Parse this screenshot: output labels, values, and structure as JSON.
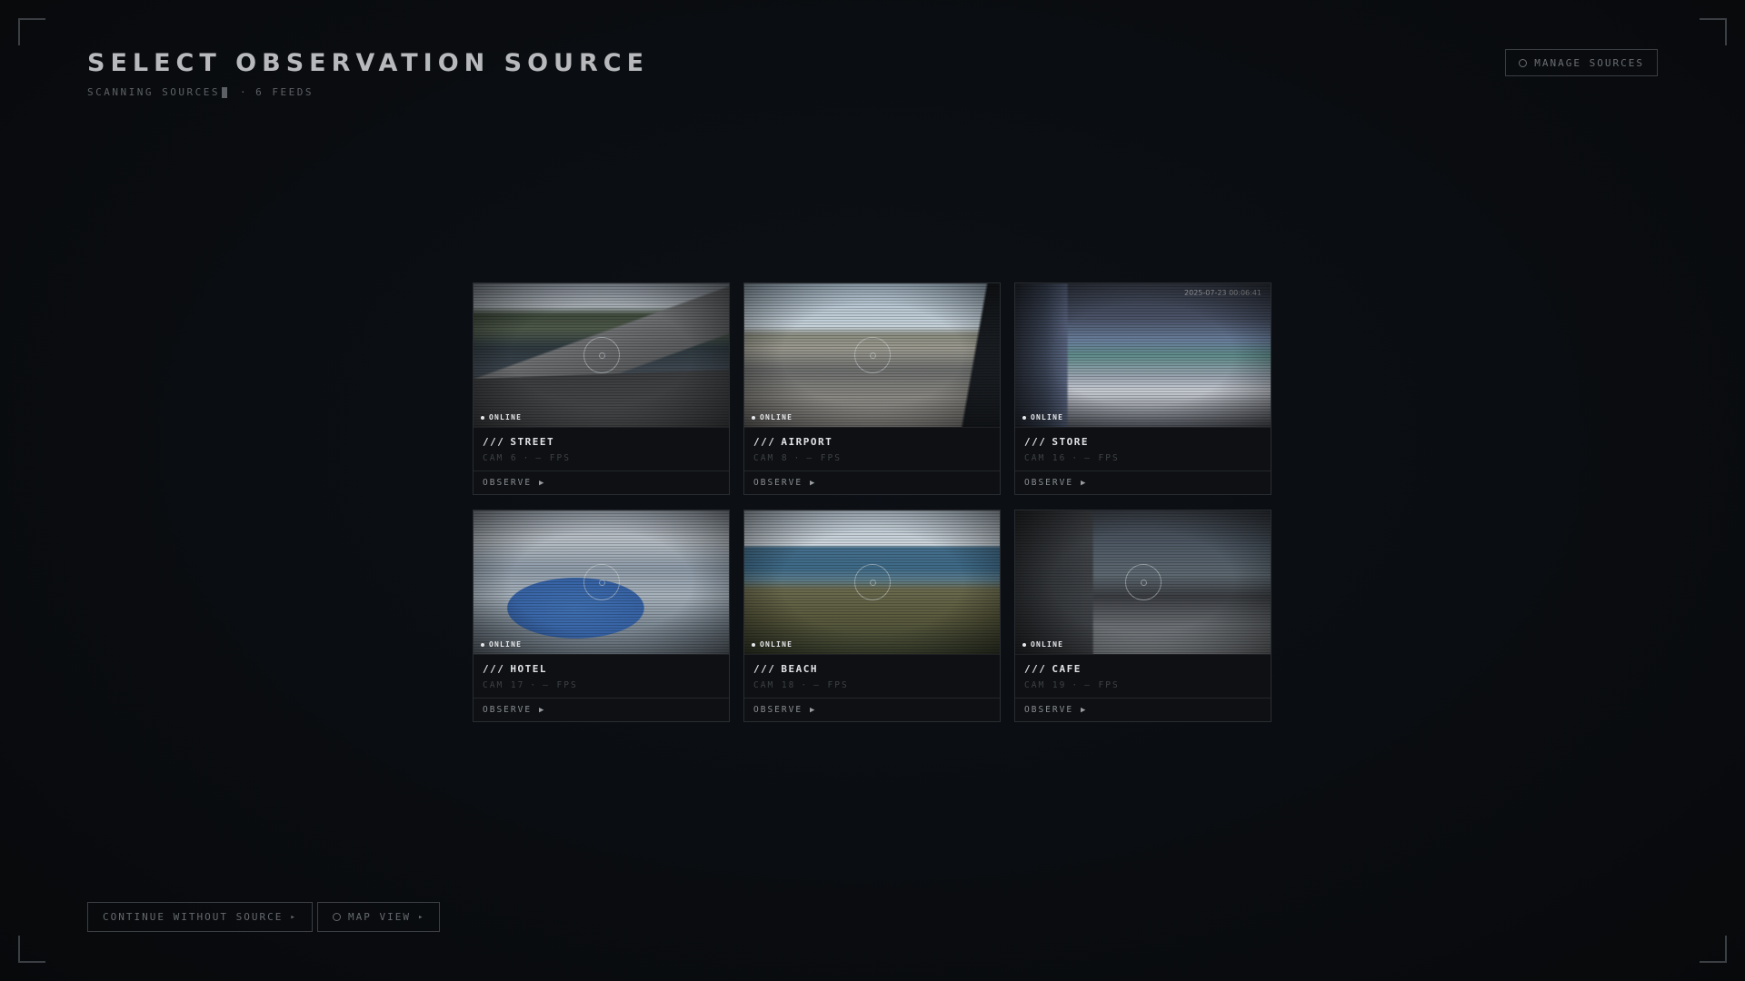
{
  "header": {
    "title": "SELECT OBSERVATION SOURCE",
    "status_text": "SCANNING SOURCES",
    "separator": "·",
    "feed_count": "6 FEEDS",
    "manage_label": "MANAGE SOURCES"
  },
  "cards": [
    {
      "prefix": "///",
      "name": "STREET",
      "status": "ONLINE",
      "cam": "CAM 6",
      "sep": "·",
      "fps": "– FPS",
      "action": "OBSERVE",
      "arrow": "▶",
      "stamp": ""
    },
    {
      "prefix": "///",
      "name": "AIRPORT",
      "status": "ONLINE",
      "cam": "CAM 8",
      "sep": "·",
      "fps": "– FPS",
      "action": "OBSERVE",
      "arrow": "▶",
      "stamp": ""
    },
    {
      "prefix": "///",
      "name": "STORE",
      "status": "ONLINE",
      "cam": "CAM 16",
      "sep": "·",
      "fps": "– FPS",
      "action": "OBSERVE",
      "arrow": "▶",
      "stamp": "2025-07-23 00:06:41"
    },
    {
      "prefix": "///",
      "name": "HOTEL",
      "status": "ONLINE",
      "cam": "CAM 17",
      "sep": "·",
      "fps": "– FPS",
      "action": "OBSERVE",
      "arrow": "▶",
      "stamp": ""
    },
    {
      "prefix": "///",
      "name": "BEACH",
      "status": "ONLINE",
      "cam": "CAM 18",
      "sep": "·",
      "fps": "– FPS",
      "action": "OBSERVE",
      "arrow": "▶",
      "stamp": ""
    },
    {
      "prefix": "///",
      "name": "CAFE",
      "status": "ONLINE",
      "cam": "CAM 19",
      "sep": "·",
      "fps": "– FPS",
      "action": "OBSERVE",
      "arrow": "▶",
      "stamp": ""
    }
  ],
  "footer": {
    "continue_label": "CONTINUE WITHOUT SOURCE",
    "continue_arrow": "▸",
    "map_label": "MAP VIEW",
    "map_arrow": "▸"
  },
  "icons": {
    "manage": "gear-icon",
    "map": "globe-icon",
    "status": "status-dot-icon",
    "observe": "play-icon",
    "reticle": "reticle-icon"
  },
  "colors": {
    "background": "#0a0d11",
    "title": "#b7b9bc",
    "muted": "#5d6165",
    "border": "#2a2d31",
    "online": "#e5e7ea"
  }
}
